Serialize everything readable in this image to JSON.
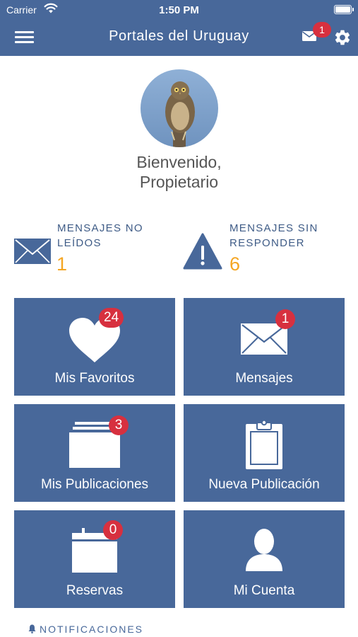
{
  "status_bar": {
    "carrier": "Carrier",
    "time": "1:50 PM"
  },
  "nav": {
    "title": "Portales del Uruguay",
    "mail_badge": "1"
  },
  "profile": {
    "welcome_line1": "Bienvenido,",
    "welcome_line2": "Propietario"
  },
  "stats": {
    "unread": {
      "label_line1": "MENSAJES NO",
      "label_line2": "LEÍDOS",
      "value": "1"
    },
    "unanswered": {
      "label_line1": "MENSAJES SIN",
      "label_line2": "RESPONDER",
      "value": "6"
    }
  },
  "tiles": {
    "favoritos": {
      "label": "Mis Favoritos",
      "badge": "24"
    },
    "mensajes": {
      "label": "Mensajes",
      "badge": "1"
    },
    "publicaciones": {
      "label": "Mis Publicaciones",
      "badge": "3"
    },
    "nueva": {
      "label": "Nueva Publicación"
    },
    "reservas": {
      "label": "Reservas",
      "badge": "0"
    },
    "cuenta": {
      "label": "Mi Cuenta"
    }
  },
  "footer": {
    "notifications_label": "NOTIFICACIONES"
  },
  "colors": {
    "primary": "#48689a",
    "badge": "#d7303f",
    "accent": "#f5a623",
    "stat_label": "#3e5b86"
  },
  "icons": [
    "menu-icon",
    "mail-icon",
    "gear-icon",
    "warning-icon",
    "heart-icon",
    "envelope-icon",
    "folders-icon",
    "clipboard-icon",
    "calendar-icon",
    "person-icon",
    "bell-icon"
  ]
}
